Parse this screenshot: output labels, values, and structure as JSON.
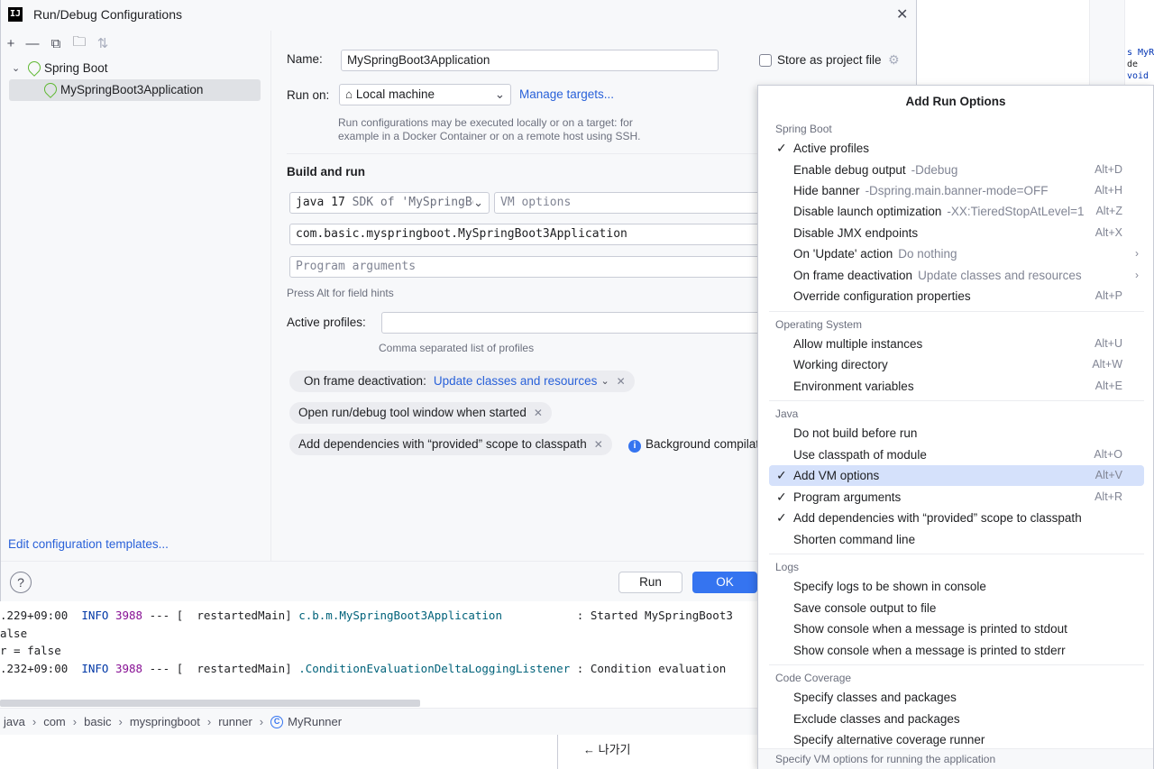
{
  "background": {
    "code_fragments": [
      "s MyR",
      "de",
      "void"
    ],
    "console": [
      {
        "time": ".229+09:00",
        "level": "INFO",
        "pid": "3988",
        "sep": "--- [",
        "thread": "restartedMain]",
        "logger": "c.b.m.MySpringBoot3Application",
        "message": ": Started MySpringBoot3"
      },
      {
        "text": "alse"
      },
      {
        "text": "r = false"
      },
      {
        "time": ".232+09:00",
        "level": "INFO",
        "pid": "3988",
        "sep": "--- [",
        "thread": "restartedMain]",
        "logger": ".ConditionEvaluationDeltaLoggingListener",
        "message": ": Condition evaluation"
      }
    ],
    "breadcrumb": [
      "java",
      "com",
      "basic",
      "myspringboot",
      "runner",
      "MyRunner"
    ],
    "breadcrumb_class_icon": "C",
    "back_label": "나가기"
  },
  "dialog": {
    "title": "Run/Debug Configurations",
    "logo": "IJ",
    "tree": {
      "group": "Spring Boot",
      "item": "MySpringBoot3Application"
    },
    "edit_templates": "Edit configuration templates...",
    "name_label": "Name:",
    "name_value": "MySpringBoot3Application",
    "store_label": "Store as project file",
    "run_on_label": "Run on:",
    "run_on_value": "Local machine",
    "manage_targets": "Manage targets...",
    "run_on_hint_1": "Run configurations may be executed locally or on a target: for",
    "run_on_hint_2": "example in a Docker Container or on a remote host using SSH.",
    "build_run_title": "Build and run",
    "jdk_version": "java 17",
    "jdk_detail": "SDK of 'MySpringBo",
    "vm_placeholder": "VM options",
    "main_class": "com.basic.myspringboot.MySpringBoot3Application",
    "program_args_placeholder": "Program arguments",
    "alt_hint": "Press Alt for field hints",
    "active_profiles_label": "Active profiles:",
    "active_profiles_value": "",
    "profiles_hint": "Comma separated list of profiles",
    "chips": {
      "frame_label": "On frame deactivation:",
      "frame_value": "Update classes and resources",
      "tool_window": "Open run/debug tool window when started",
      "provided": "Add dependencies with “provided” scope to classpath",
      "background": "Background compilati"
    },
    "buttons": {
      "help": "?",
      "run": "Run",
      "ok": "OK"
    }
  },
  "popup": {
    "title": "Add Run Options",
    "groups": [
      {
        "name": "Spring Boot",
        "items": [
          {
            "label": "Active profiles",
            "extra": "",
            "shortcut": "",
            "checked": true,
            "submenu": false
          },
          {
            "label": "Enable debug output",
            "extra": "-Ddebug",
            "shortcut": "Alt+D",
            "checked": false,
            "submenu": false
          },
          {
            "label": "Hide banner",
            "extra": "-Dspring.main.banner-mode=OFF",
            "shortcut": "Alt+H",
            "checked": false,
            "submenu": false
          },
          {
            "label": "Disable launch optimization",
            "extra": "-XX:TieredStopAtLevel=1",
            "shortcut": "Alt+Z",
            "checked": false,
            "submenu": false
          },
          {
            "label": "Disable JMX endpoints",
            "extra": "",
            "shortcut": "Alt+X",
            "checked": false,
            "submenu": false
          },
          {
            "label": "On 'Update' action",
            "extra": "Do nothing",
            "shortcut": "",
            "checked": false,
            "submenu": true
          },
          {
            "label": "On frame deactivation",
            "extra": "Update classes and resources",
            "shortcut": "",
            "checked": false,
            "submenu": true
          },
          {
            "label": "Override configuration properties",
            "extra": "",
            "shortcut": "Alt+P",
            "checked": false,
            "submenu": false
          }
        ]
      },
      {
        "name": "Operating System",
        "items": [
          {
            "label": "Allow multiple instances",
            "extra": "",
            "shortcut": "Alt+U",
            "checked": false,
            "submenu": false
          },
          {
            "label": "Working directory",
            "extra": "",
            "shortcut": "Alt+W",
            "checked": false,
            "submenu": false
          },
          {
            "label": "Environment variables",
            "extra": "",
            "shortcut": "Alt+E",
            "checked": false,
            "submenu": false
          }
        ]
      },
      {
        "name": "Java",
        "items": [
          {
            "label": "Do not build before run",
            "extra": "",
            "shortcut": "",
            "checked": false,
            "submenu": false
          },
          {
            "label": "Use classpath of module",
            "extra": "",
            "shortcut": "Alt+O",
            "checked": false,
            "submenu": false
          },
          {
            "label": "Add VM options",
            "extra": "",
            "shortcut": "Alt+V",
            "checked": true,
            "submenu": false,
            "selected": true
          },
          {
            "label": "Program arguments",
            "extra": "",
            "shortcut": "Alt+R",
            "checked": true,
            "submenu": false
          },
          {
            "label": "Add dependencies with “provided” scope to classpath",
            "extra": "",
            "shortcut": "",
            "checked": true,
            "submenu": false
          },
          {
            "label": "Shorten command line",
            "extra": "",
            "shortcut": "",
            "checked": false,
            "submenu": false
          }
        ]
      },
      {
        "name": "Logs",
        "items": [
          {
            "label": "Specify logs to be shown in console",
            "extra": "",
            "shortcut": "",
            "checked": false,
            "submenu": false
          },
          {
            "label": "Save console output to file",
            "extra": "",
            "shortcut": "",
            "checked": false,
            "submenu": false
          },
          {
            "label": "Show console when a message is printed to stdout",
            "extra": "",
            "shortcut": "",
            "checked": false,
            "submenu": false
          },
          {
            "label": "Show console when a message is printed to stderr",
            "extra": "",
            "shortcut": "",
            "checked": false,
            "submenu": false
          }
        ]
      },
      {
        "name": "Code Coverage",
        "items": [
          {
            "label": "Specify classes and packages",
            "extra": "",
            "shortcut": "",
            "checked": false,
            "submenu": false
          },
          {
            "label": "Exclude classes and packages",
            "extra": "",
            "shortcut": "",
            "checked": false,
            "submenu": false
          },
          {
            "label": "Specify alternative coverage runner",
            "extra": "",
            "shortcut": "",
            "checked": false,
            "submenu": false
          }
        ]
      }
    ],
    "footer_hint": "Specify VM options for running the application"
  },
  "colors": {
    "accent": "#3574f0",
    "link": "#2961d9",
    "selection": "#d5e1fb",
    "spring": "#5fb832"
  }
}
